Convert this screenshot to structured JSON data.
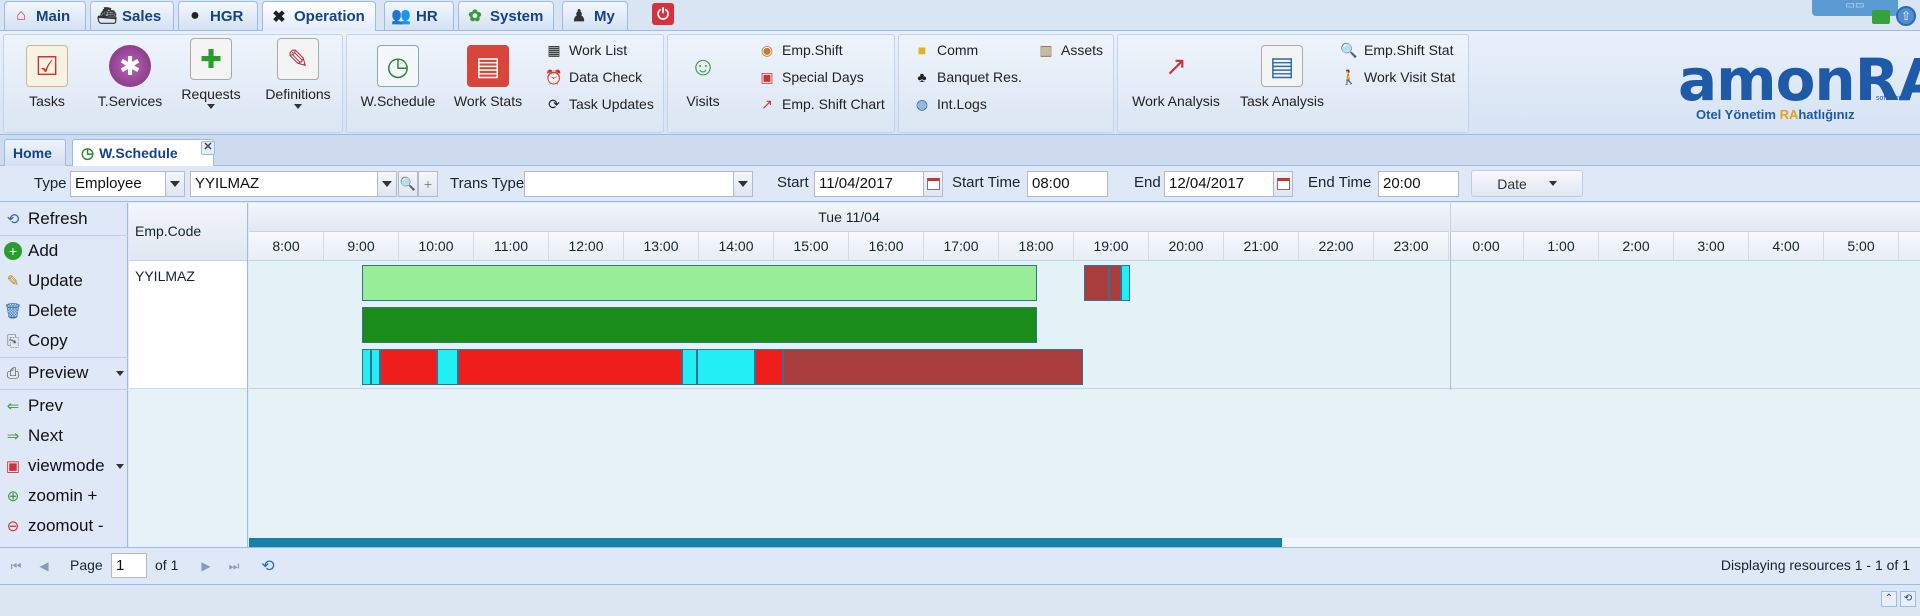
{
  "main_tabs": [
    {
      "label": "Main",
      "icon": "home-icon"
    },
    {
      "label": "Sales",
      "icon": "ship-icon"
    },
    {
      "label": "HGR",
      "icon": "chat-icon"
    },
    {
      "label": "Operation",
      "icon": "tools-icon"
    },
    {
      "label": "HR",
      "icon": "people-icon"
    },
    {
      "label": "System",
      "icon": "system-icon"
    },
    {
      "label": "My",
      "icon": "user-icon"
    }
  ],
  "ribbon": {
    "tasks": "Tasks",
    "tservices": "T.Services",
    "requests": "Requests",
    "definitions": "Definitions",
    "wschedule": "W.Schedule",
    "workstats": "Work Stats",
    "worklist": "Work List",
    "datacheck": "Data Check",
    "taskupdates": "Task Updates",
    "visits": "Visits",
    "empshift": "Emp.Shift",
    "specialdays": "Special Days",
    "empshiftchart": "Emp. Shift Chart",
    "comm": "Comm",
    "banquet": "Banquet Res.",
    "intlogs": "Int.Logs",
    "assets": "Assets",
    "workanalysis": "Work Analysis",
    "taskanalysis": "Task Analysis",
    "empshiftstat": "Emp.Shift Stat",
    "workvisitstat": "Work Visit Stat"
  },
  "logo": {
    "brand_a": "amon",
    "brand_b": "RA",
    "software": "software",
    "tag_a": "Otel Yönetim ",
    "tag_b": "RA",
    "tag_c": "hatlığınız"
  },
  "page_tabs": {
    "home": "Home",
    "wschedule": "W.Schedule"
  },
  "filters": {
    "type_label": "Type",
    "type_value": "Employee",
    "employee_value": "YYILMAZ",
    "trans_type_label": "Trans Type",
    "trans_type_value": "",
    "start_label": "Start",
    "start_value": "11/04/2017",
    "start_time_label": "Start Time",
    "start_time_value": "08:00",
    "end_label": "End",
    "end_value": "12/04/2017",
    "end_time_label": "End Time",
    "end_time_value": "20:00",
    "date_button": "Date"
  },
  "toolbar": {
    "refresh": "Refresh",
    "add": "Add",
    "update": "Update",
    "delete": "Delete",
    "copy": "Copy",
    "preview": "Preview",
    "prev": "Prev",
    "next": "Next",
    "viewmode": "viewmode",
    "zoomin": "zoomin +",
    "zoomout": "zoomout -"
  },
  "scheduler": {
    "resource_header": "Emp.Code",
    "resource": "YYILMAZ",
    "day_label": "Tue 11/04",
    "hours": [
      "8:00",
      "9:00",
      "10:00",
      "11:00",
      "12:00",
      "13:00",
      "14:00",
      "15:00",
      "16:00",
      "17:00",
      "18:00",
      "19:00",
      "20:00",
      "21:00",
      "22:00",
      "23:00",
      "0:00",
      "1:00",
      "2:00",
      "3:00",
      "4:00",
      "5:00"
    ],
    "events": [
      {
        "row": 0,
        "start": 9.0,
        "end": 18.0,
        "color": "#98ee98"
      },
      {
        "row": 0,
        "start": 18.63,
        "end": 18.97,
        "color": "#a93d3d"
      },
      {
        "row": 0,
        "start": 18.97,
        "end": 19.13,
        "color": "#a93d3d"
      },
      {
        "row": 0,
        "start": 19.13,
        "end": 19.25,
        "color": "#21eef5"
      },
      {
        "row": 1,
        "start": 9.0,
        "end": 18.0,
        "color": "#1a8c1a"
      },
      {
        "row": 2,
        "start": 9.0,
        "end": 9.13,
        "color": "#21eef5"
      },
      {
        "row": 2,
        "start": 9.13,
        "end": 9.25,
        "color": "#21eef5"
      },
      {
        "row": 2,
        "start": 9.25,
        "end": 10.0,
        "color": "#f01d1d"
      },
      {
        "row": 2,
        "start": 10.0,
        "end": 10.28,
        "color": "#21eef5"
      },
      {
        "row": 2,
        "start": 10.28,
        "end": 13.27,
        "color": "#f01d1d"
      },
      {
        "row": 2,
        "start": 13.27,
        "end": 13.47,
        "color": "#21eef5"
      },
      {
        "row": 2,
        "start": 13.47,
        "end": 14.25,
        "color": "#21eef5"
      },
      {
        "row": 2,
        "start": 14.25,
        "end": 14.62,
        "color": "#f01d1d"
      },
      {
        "row": 2,
        "start": 14.62,
        "end": 18.62,
        "color": "#a93d3d"
      }
    ]
  },
  "pager": {
    "page_label": "Page",
    "page_value": "1",
    "of_label": "of 1",
    "display_text": "Displaying resources 1 - 1 of 1"
  }
}
